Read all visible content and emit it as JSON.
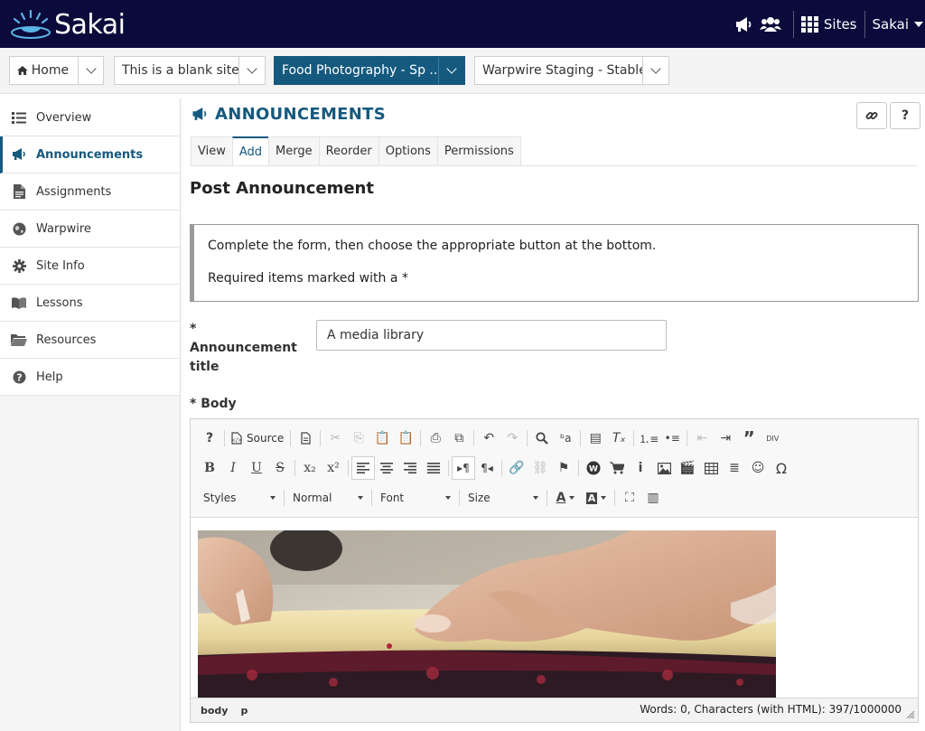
{
  "header": {
    "logo_text": "Sakai",
    "sites_label": "Sites",
    "user_label": "Sakai",
    "colors": {
      "background": "#0b0b3b",
      "accent": "#15597e"
    }
  },
  "site_tabs": [
    {
      "label": "Home"
    },
    {
      "label": "This is a blank site"
    },
    {
      "label": "Food Photography - Sp ..."
    },
    {
      "label": "Warpwire Staging - Stable"
    }
  ],
  "sidebar": {
    "items": [
      {
        "label": "Overview",
        "icon": "list-icon"
      },
      {
        "label": "Announcements",
        "icon": "megaphone-icon"
      },
      {
        "label": "Assignments",
        "icon": "document-icon"
      },
      {
        "label": "Warpwire",
        "icon": "globe-icon"
      },
      {
        "label": "Site Info",
        "icon": "gear-icon"
      },
      {
        "label": "Lessons",
        "icon": "book-icon"
      },
      {
        "label": "Resources",
        "icon": "folder-icon"
      },
      {
        "label": "Help",
        "icon": "question-icon"
      }
    ]
  },
  "tool": {
    "title": "ANNOUNCEMENTS",
    "link_btn": "🔗",
    "help_btn": "?"
  },
  "tabs": [
    "View",
    "Add",
    "Merge",
    "Reorder",
    "Options",
    "Permissions"
  ],
  "page": {
    "heading": "Post Announcement",
    "instruction_1": "Complete the form, then choose the appropriate button at the bottom.",
    "instruction_2": "Required items marked with a *"
  },
  "form": {
    "title_label_star": "*",
    "title_label": "Announcement title",
    "title_value": "A media library",
    "body_label": "* Body"
  },
  "editor": {
    "source_label": "Source",
    "styles_label": "Styles",
    "format_label": "Normal",
    "font_label": "Font",
    "size_label": "Size",
    "path_1": "body",
    "path_2": "p",
    "word_count": "Words: 0, Characters (with HTML): 397/1000000"
  }
}
